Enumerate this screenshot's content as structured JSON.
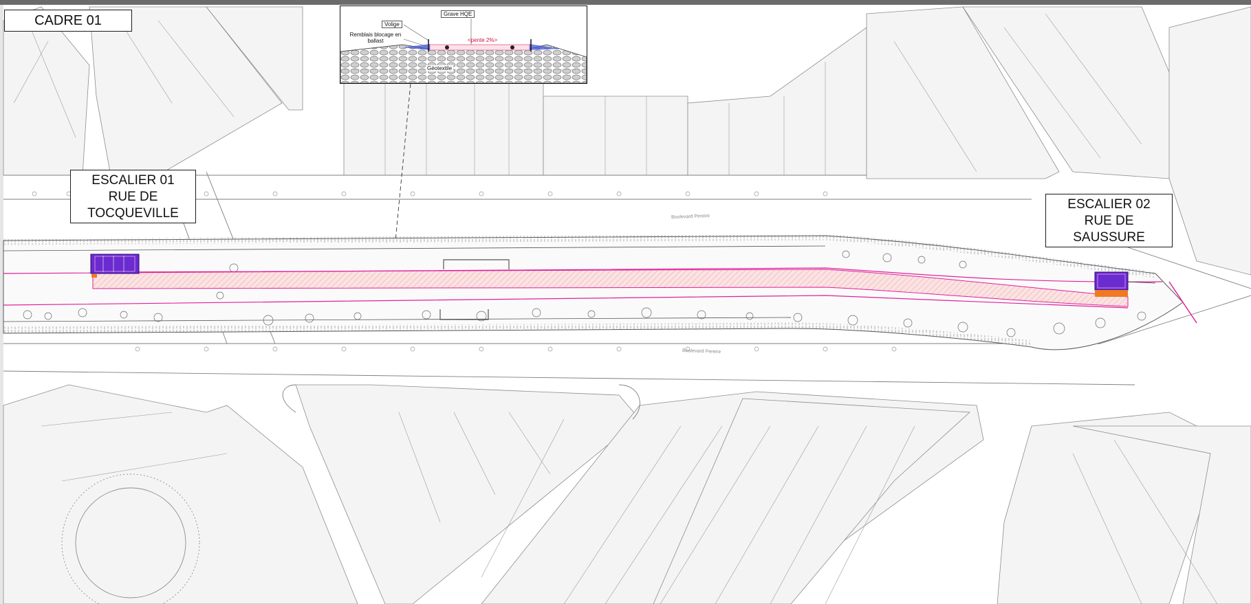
{
  "labels": {
    "cadre": "CADRE 01",
    "escalier_01": [
      "ESCALIER 01",
      "RUE DE",
      "TOCQUEVILLE"
    ],
    "escalier_02": [
      "ESCALIER 02",
      "RUE DE",
      "SAUSSURE"
    ]
  },
  "inset": {
    "grave": "Grave HQE",
    "volige": "Volige",
    "remblais": "Remblais blocage en ballast",
    "pente": "<pente 2%>",
    "geotextile": "Géotextile"
  },
  "streets": {
    "top": "Boulevard Pereire",
    "bottom": "Boulevard Pereire"
  },
  "colors": {
    "line": "#8c8c8c",
    "building_fill": "#f3f3f3",
    "path_magenta": "#e0209a",
    "path_hatch": "#f6c9c9",
    "stair_purple": "#6a2bd1",
    "stair_orange": "#f07a22"
  }
}
